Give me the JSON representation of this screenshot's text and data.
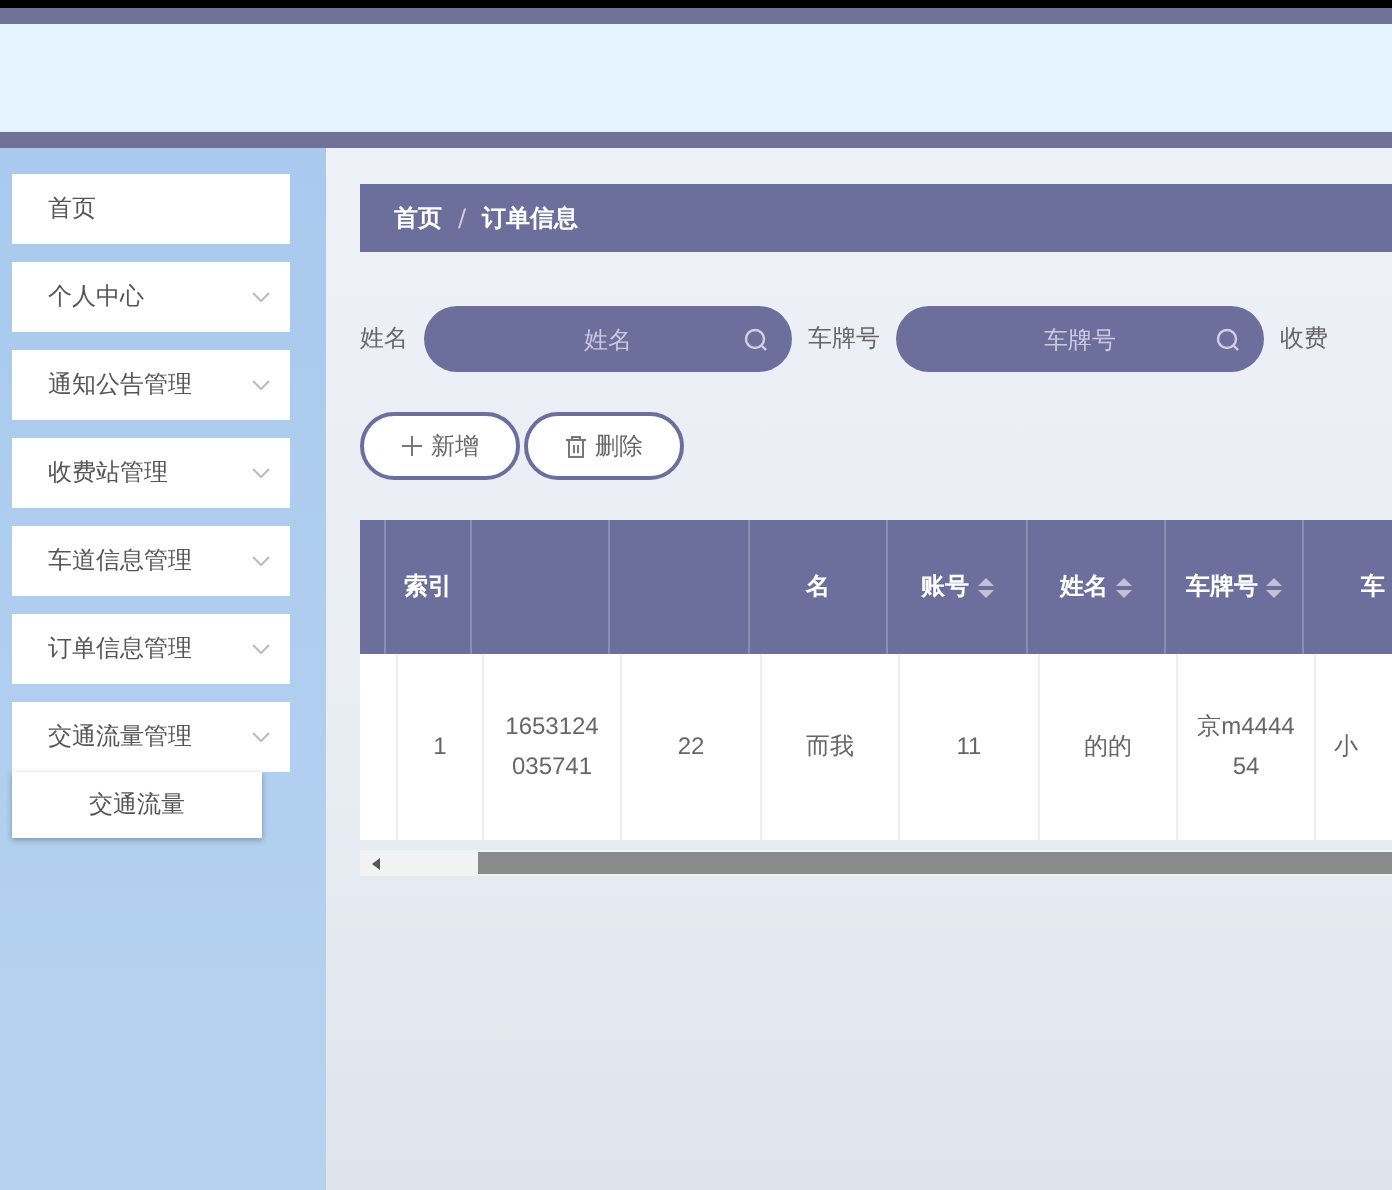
{
  "sidebar": {
    "items": [
      {
        "label": "首页",
        "has_arrow": false
      },
      {
        "label": "个人中心",
        "has_arrow": true
      },
      {
        "label": "通知公告管理",
        "has_arrow": true
      },
      {
        "label": "收费站管理",
        "has_arrow": true
      },
      {
        "label": "车道信息管理",
        "has_arrow": true
      },
      {
        "label": "订单信息管理",
        "has_arrow": true
      },
      {
        "label": "交通流量管理",
        "has_arrow": true,
        "children": [
          {
            "label": "交通流量"
          }
        ]
      }
    ]
  },
  "breadcrumb": {
    "items": [
      "首页",
      "订单信息"
    ],
    "separator": "/"
  },
  "search": [
    {
      "label": "姓名",
      "placeholder": "姓名"
    },
    {
      "label": "车牌号",
      "placeholder": "车牌号"
    },
    {
      "label": "收费"
    }
  ],
  "buttons": [
    {
      "kind": "add",
      "label": "新增"
    },
    {
      "kind": "delete",
      "label": "删除"
    }
  ],
  "table": {
    "columns": [
      {},
      {
        "label": "索引",
        "sortable": false
      },
      {
        "sortable": false
      },
      {
        "sortable": false
      },
      {
        "label": "名",
        "sortable": false
      },
      {
        "label": "账号",
        "sortable": true
      },
      {
        "label": "姓名",
        "sortable": true
      },
      {
        "label": "车牌号",
        "sortable": true
      },
      {
        "label": "车",
        "sortable": false
      }
    ],
    "rows": [
      [
        "",
        "1",
        "1653124035741",
        "22",
        "而我",
        "11",
        "的的",
        "京m444454",
        "小"
      ]
    ]
  }
}
